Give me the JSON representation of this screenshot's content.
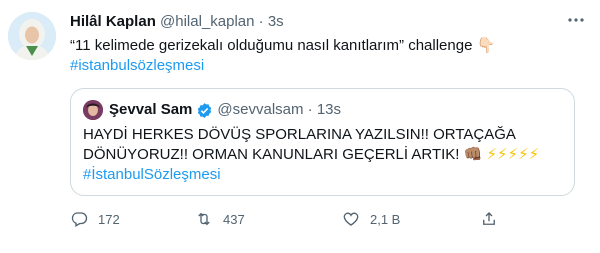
{
  "author": {
    "name": "Hilâl Kaplan",
    "handle": "@hilal_kaplan",
    "separator": "·",
    "time": "3s"
  },
  "tweet": {
    "text": "“11 kelimede gerizekalı olduğumu nasıl kanıtlarım” challenge",
    "emoji": "👇🏻",
    "hashtag": "#istanbulsözleşmesi"
  },
  "quote": {
    "name": "Şevval Sam",
    "handle": "@sevvalsam",
    "separator": "·",
    "time": "13s",
    "line1": "HAYDİ HERKES DÖVÜŞ SPORLARINA YAZILSIN!! ORTAÇAĞA",
    "line2": "DÖNÜYORUZ!! ORMAN KANUNLARI GEÇERLİ ARTIK!",
    "emojis": "👊🏽 ⚡⚡⚡⚡⚡",
    "hashtag": "#İstanbulSözleşmesi"
  },
  "actions": {
    "replies": "172",
    "retweets": "437",
    "likes": "2,1 B"
  },
  "colors": {
    "accent": "#1d9bf0",
    "muted": "#536471",
    "border": "#cfd9de"
  },
  "icons": [
    "more-icon",
    "verified-icon",
    "reply-icon",
    "retweet-icon",
    "like-icon",
    "share-icon"
  ]
}
